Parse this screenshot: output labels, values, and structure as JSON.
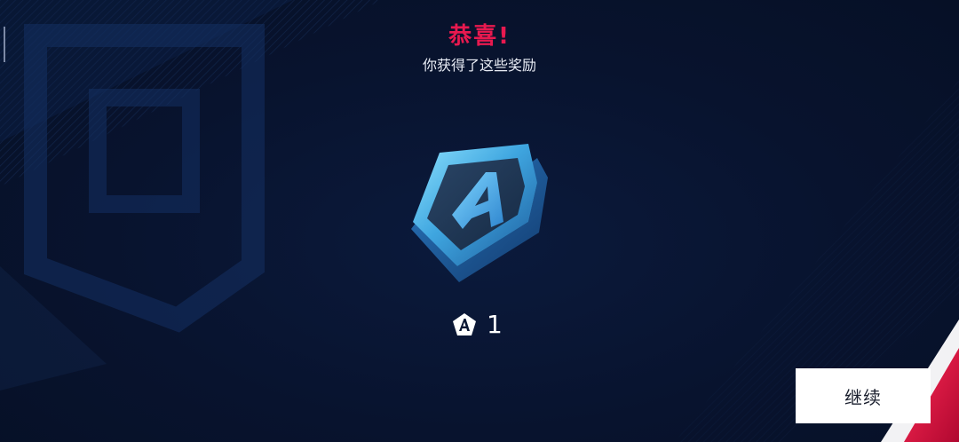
{
  "header": {
    "title": "恭喜!",
    "subtitle": "你获得了这些奖励"
  },
  "reward": {
    "icon": "a-emblem-icon",
    "count": "1"
  },
  "actions": {
    "continue_label": "继续"
  },
  "colors": {
    "background": "#08122a",
    "title": "#e8194f",
    "emblem_blue": "#3fa6e0",
    "accent_red": "#e0103f",
    "button_bg": "#ffffff"
  }
}
